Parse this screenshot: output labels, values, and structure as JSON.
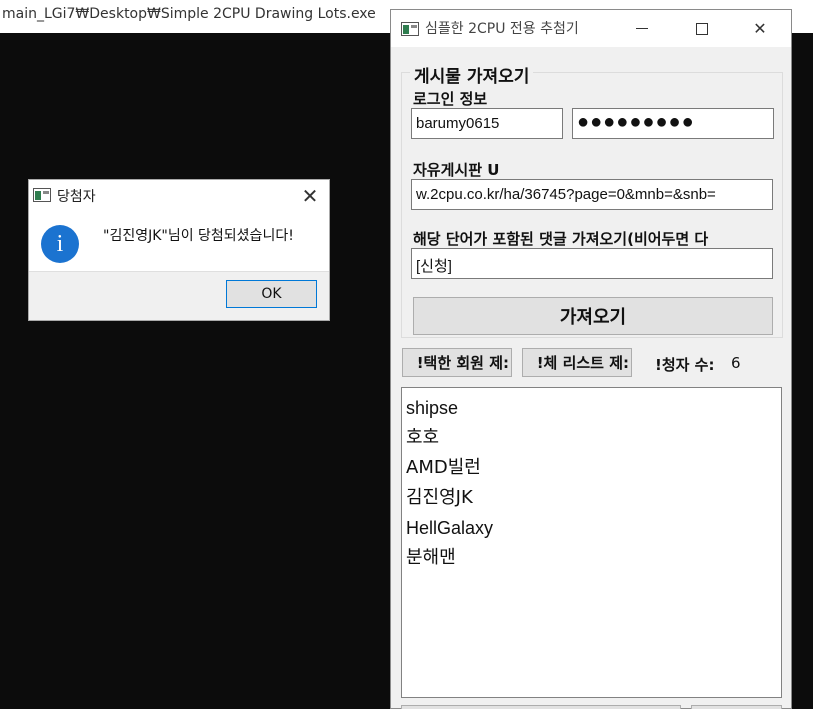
{
  "console": {
    "title": "main_LGi7₩Desktop₩Simple 2CPU Drawing Lots.exe"
  },
  "main_window": {
    "title": "심플한 2CPU 전용 추첨기",
    "group": {
      "title": "게시물 가져오기",
      "login_label": "로그인 정보",
      "username": "barumy0615",
      "password_mask": "●●●●●●●●●",
      "board_url_label": "자유게시판 U",
      "board_url": "w.2cpu.co.kr/ha/36745?page=0&mnb=&snb=",
      "keyword_label": "해당 단어가 포함된 댓글 가져오기(비어두면 다",
      "keyword": "[신청]",
      "fetch_button": "가져오기"
    },
    "remove_selected_button": "!택한 회원 제:",
    "remove_all_button": "!체 리스트 제:",
    "applicant_count_label": "!청자 수:",
    "applicant_count": "6",
    "applicants": [
      "shipse",
      "호호",
      "AMD빌런",
      "김진영JK",
      "HellGalaxy",
      "분해맨"
    ]
  },
  "dialog": {
    "title": "당첨자",
    "close_symbol": "✕",
    "icon_glyph": "i",
    "message": "\"김진영JK\"님이 당첨되셨습니다!",
    "ok_button": "OK"
  },
  "colors": {
    "console_bg": "#0c0c0c",
    "window_bg": "#f0f0f0",
    "info_icon": "#1b73d0",
    "ok_focus_border": "#0078d7"
  }
}
